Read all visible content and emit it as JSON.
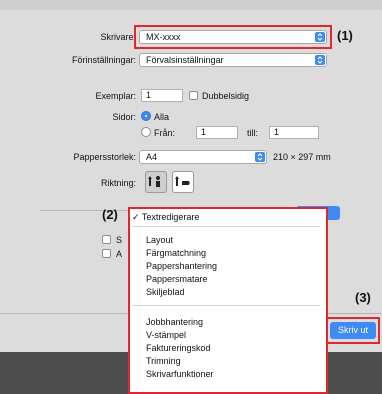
{
  "printer": {
    "label": "Skrivare:",
    "value": "MX-xxxx"
  },
  "presets": {
    "label": "Förinställningar:",
    "value": "Förvalsinställningar"
  },
  "copies": {
    "label": "Exemplar:",
    "value": "1",
    "duplex_label": "Dubbelsidig"
  },
  "pages": {
    "label": "Sidor:",
    "all_label": "Alla",
    "from_label": "Från:",
    "from_value": "1",
    "to_label": "till:",
    "to_value": "1"
  },
  "paper_size": {
    "label": "Pappersstorlek:",
    "value": "A4",
    "dimensions": "210 × 297 mm"
  },
  "orientation": {
    "label": "Riktning:"
  },
  "background_stub": {
    "s_char": "S",
    "a_char": "A"
  },
  "menu": {
    "checked_item": "Textredigerare",
    "group1": [
      "Layout",
      "Färgmatchning",
      "Pappershantering",
      "Pappersmatare",
      "Skiljeblad"
    ],
    "group2": [
      "Jobbhantering",
      "V-stämpel",
      "Faktureringskod",
      "Trimning",
      "Skrivarfunktioner"
    ]
  },
  "print_button": {
    "label": "Skriv ut"
  },
  "callouts": {
    "c1": "(1)",
    "c2": "(2)",
    "c3": "(3)"
  },
  "colors": {
    "accent": "#3f8bf5",
    "highlight_border": "#e0262f"
  }
}
